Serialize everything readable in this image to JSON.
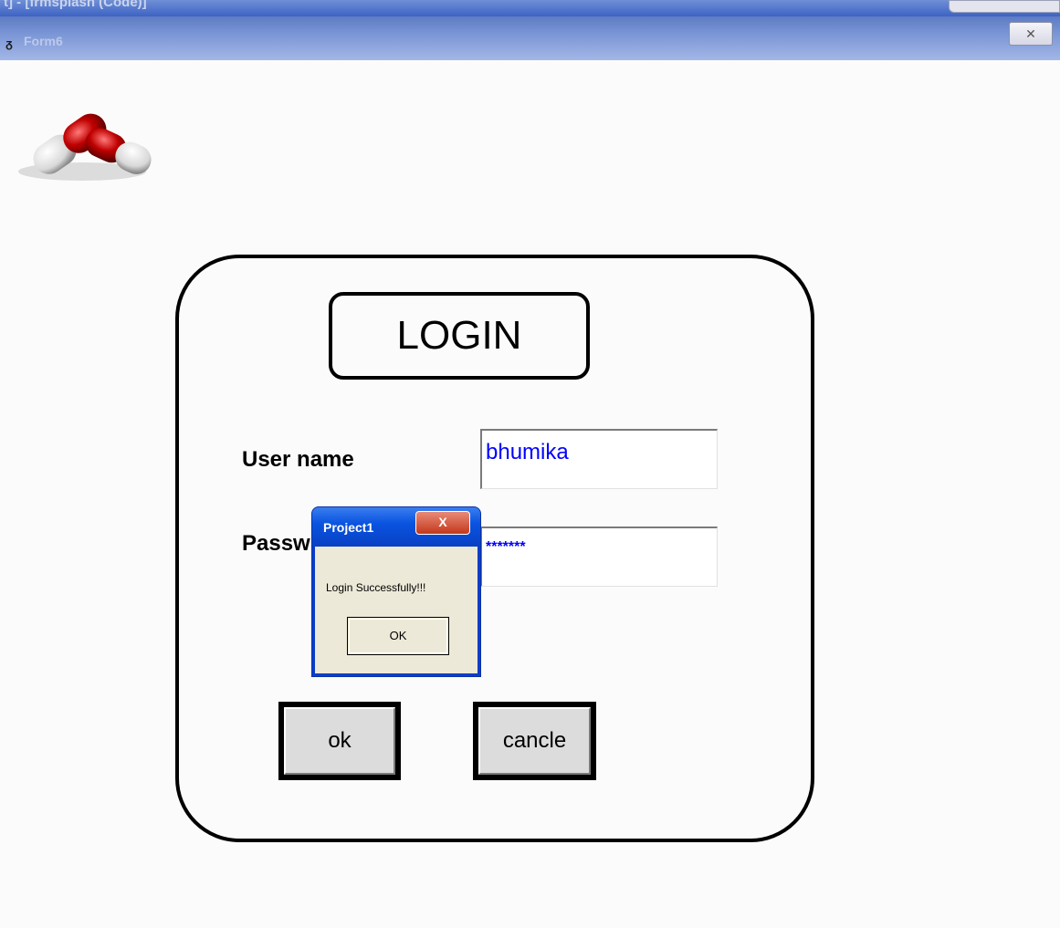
{
  "background_window": {
    "title": "t] - [frmsplash (Code)]"
  },
  "form": {
    "icon": "form-icon",
    "title": "Form6",
    "close_glyph": "✕"
  },
  "login": {
    "heading": "LOGIN",
    "username_label": "User name",
    "password_label": "Passw",
    "username_value": "bhumika",
    "password_value": "*******",
    "ok_label": "ok",
    "cancel_label": "cancle"
  },
  "message_box": {
    "title": "Project1",
    "close_glyph": "X",
    "message": "Login Successfully!!!",
    "ok_label": "OK"
  },
  "colors": {
    "input_text": "#0000ff",
    "dialog_titlebar": "#0a54e0",
    "form_titlebar": "#7b96d6"
  }
}
